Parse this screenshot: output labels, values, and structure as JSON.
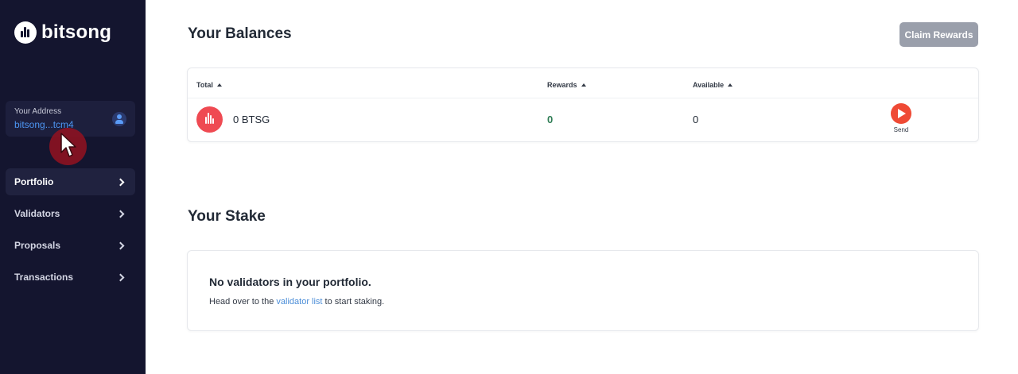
{
  "brand": {
    "name": "bitsong"
  },
  "sidebar": {
    "address": {
      "label": "Your Address",
      "value": "bitsong...tcm4"
    },
    "items": [
      {
        "label": "Portfolio",
        "active": true
      },
      {
        "label": "Validators",
        "active": false
      },
      {
        "label": "Proposals",
        "active": false
      },
      {
        "label": "Transactions",
        "active": false
      }
    ]
  },
  "balances": {
    "title": "Your Balances",
    "claim_label": "Claim Rewards",
    "columns": [
      "Total",
      "Rewards",
      "Available"
    ],
    "rows": [
      {
        "total": "0 BTSG",
        "rewards": "0",
        "available": "0",
        "action": "Send"
      }
    ]
  },
  "stake": {
    "title": "Your Stake",
    "empty_title": "No validators in your portfolio.",
    "empty_text_before": "Head over to the",
    "empty_link": "validator list",
    "empty_text_after": "to start staking."
  },
  "colors": {
    "sidebar": "#14152f",
    "accent_red": "#ef4a35",
    "link_blue": "#4c8ed8",
    "rewards_green": "#2f7d55"
  }
}
